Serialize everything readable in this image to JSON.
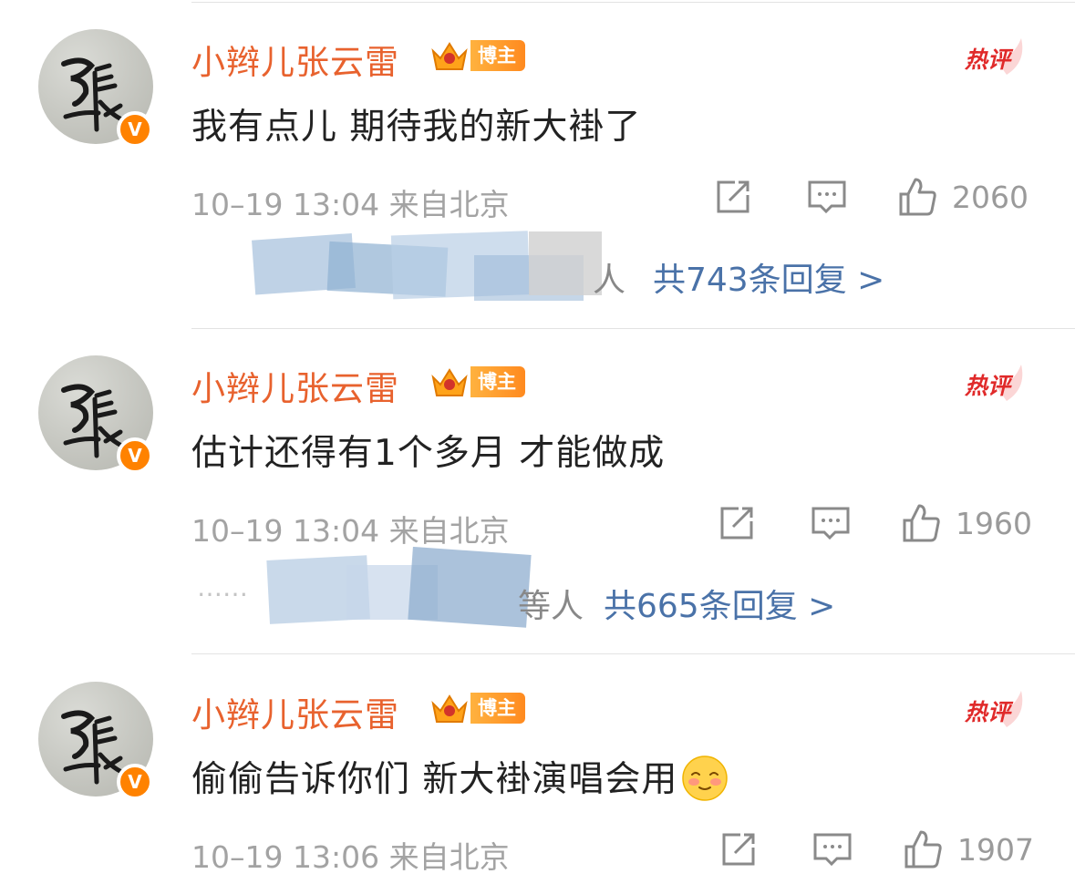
{
  "colors": {
    "username": "#e8622e",
    "badge": "#ff8200",
    "hot": "#e02a2a",
    "link": "#4a72a8",
    "meta": "#a3a3a3"
  },
  "comments": [
    {
      "username": "小辫儿张云雷",
      "badge": "博主",
      "hot_label": "热评",
      "text": "我有点儿 期待我的新大褂了",
      "meta": "10–19 13:04 来自北京",
      "likes": "2060",
      "replies_who": "人",
      "replies_text": "共743条回复 >"
    },
    {
      "username": "小辫儿张云雷",
      "badge": "博主",
      "hot_label": "热评",
      "text": "估计还得有1个多月 才能做成",
      "meta": "10–19 13:04 来自北京",
      "likes": "1960",
      "replies_who": "等人",
      "replies_prefix": "……",
      "replies_text": "共665条回复 >"
    },
    {
      "username": "小辫儿张云雷",
      "badge": "博主",
      "hot_label": "热评",
      "text": "偷偷告诉你们 新大褂演唱会用",
      "meta": "10–19 13:06 来自北京",
      "likes": "1907"
    }
  ],
  "icons": {
    "repost": "repost-icon",
    "comment": "comment-icon",
    "like": "thumbs-up-icon",
    "verified": "verified-v-icon",
    "crown": "crown-icon",
    "emoji": "shy-smile-emoji"
  }
}
